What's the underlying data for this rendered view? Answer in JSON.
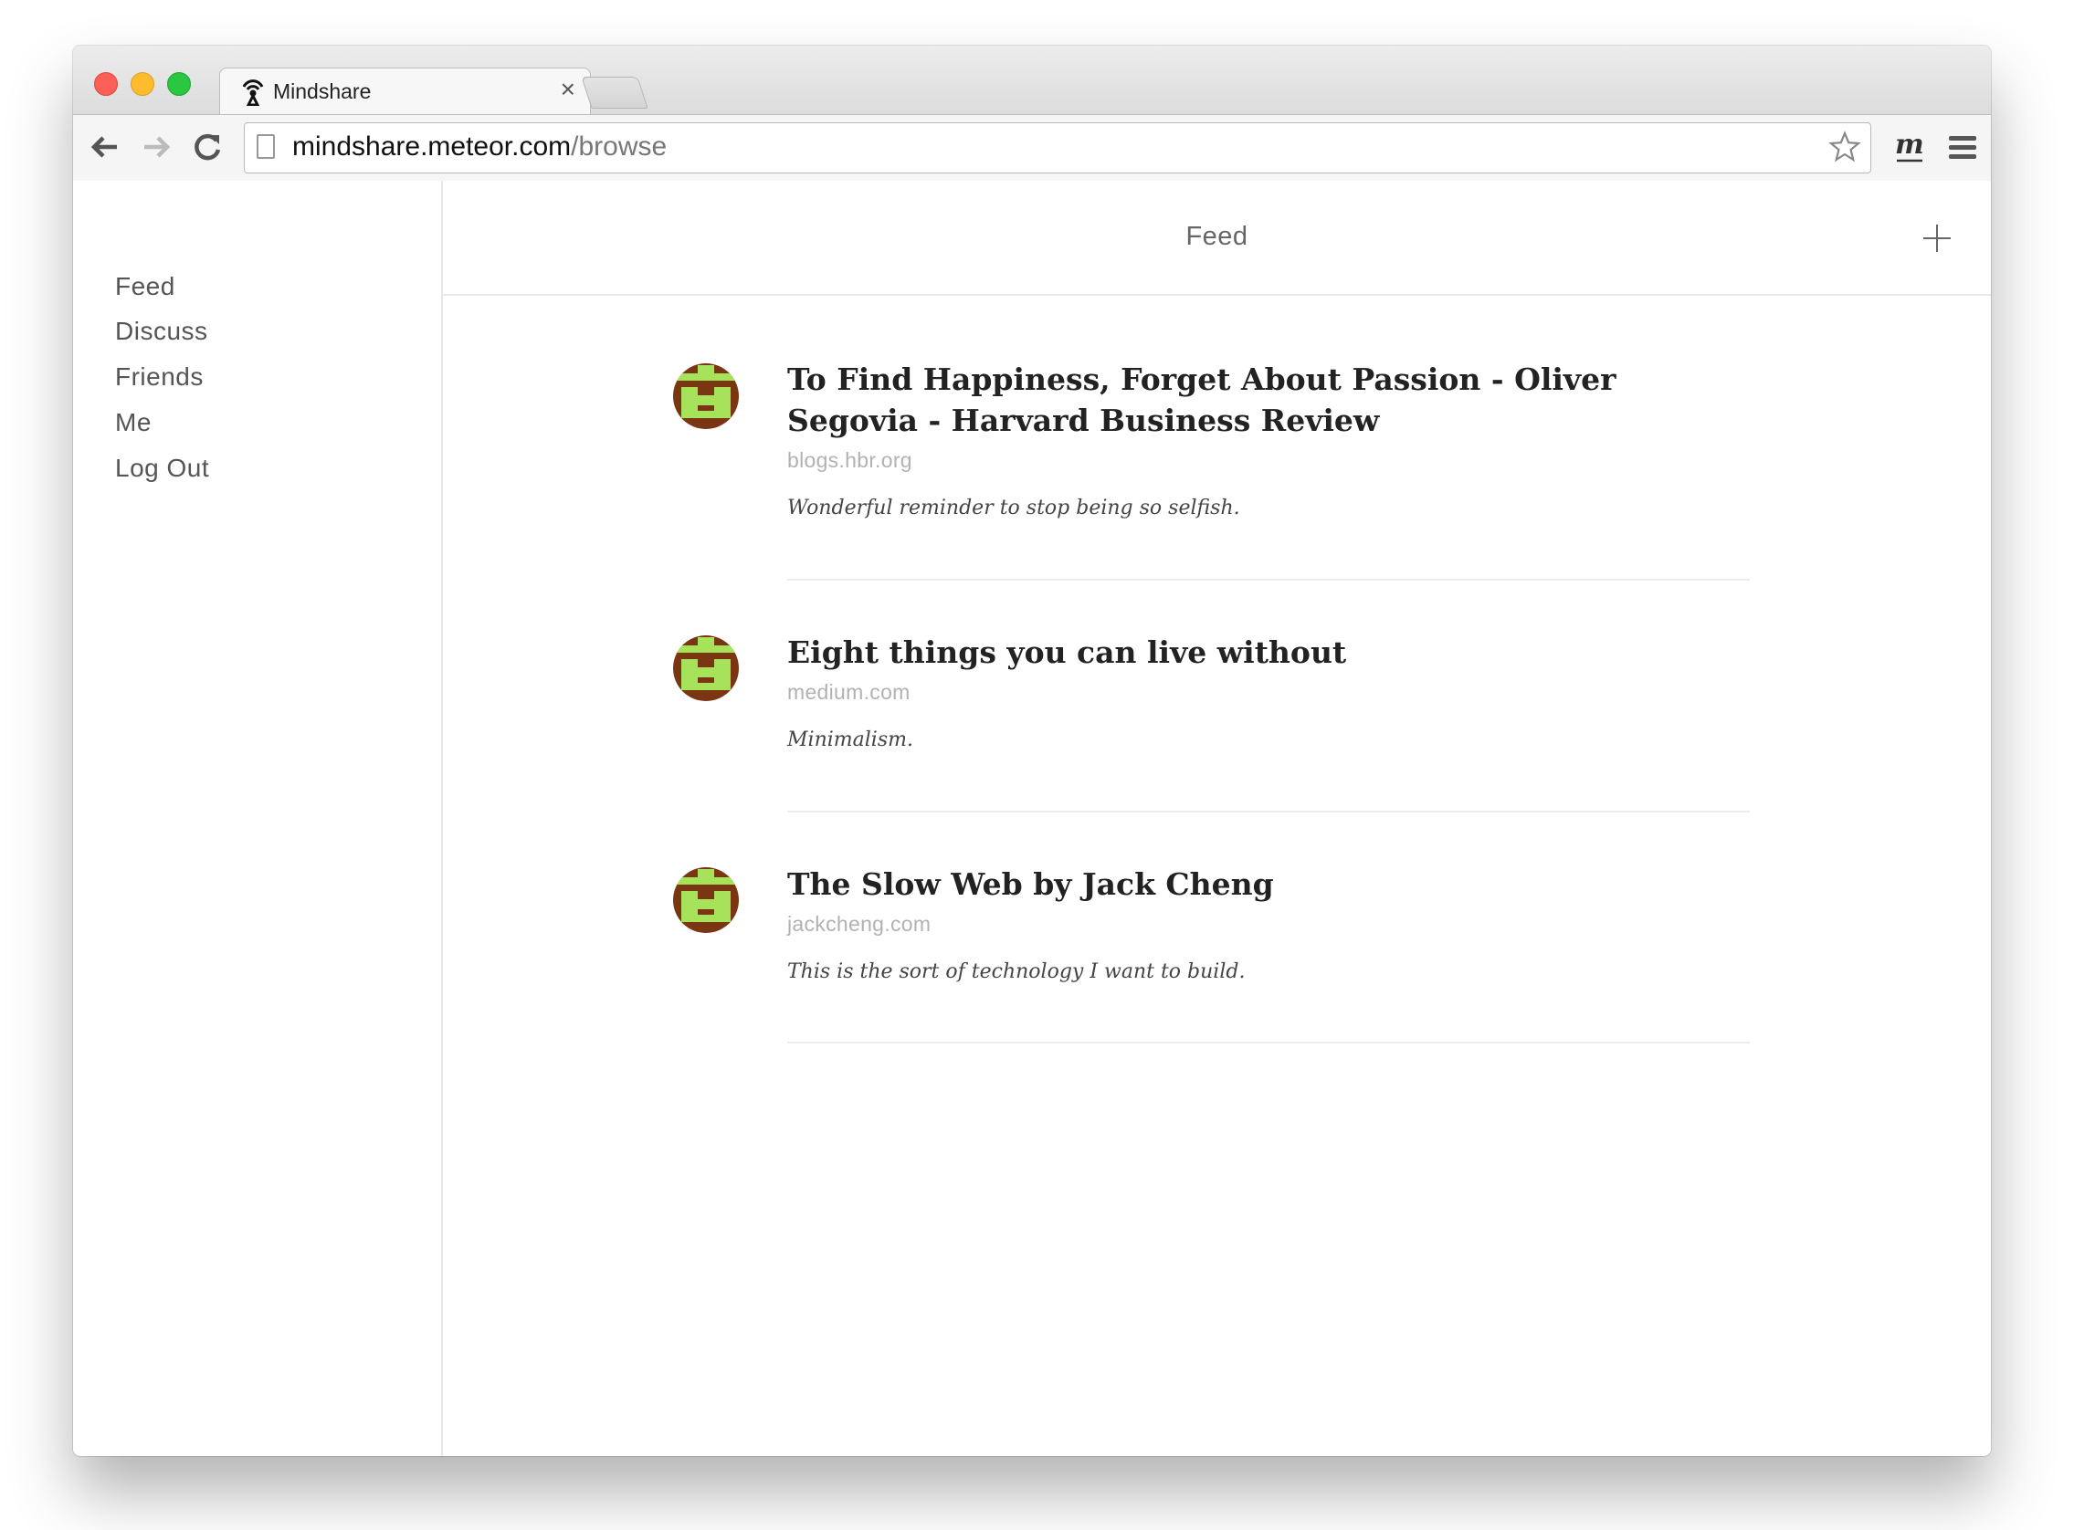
{
  "browser": {
    "tab_title": "Mindshare",
    "tab_close": "×",
    "url_host": "mindshare.meteor.com",
    "url_path": "/browse"
  },
  "sidebar": {
    "items": [
      {
        "label": "Feed"
      },
      {
        "label": "Discuss"
      },
      {
        "label": "Friends"
      },
      {
        "label": "Me"
      },
      {
        "label": "Log Out"
      }
    ]
  },
  "main": {
    "title": "Feed"
  },
  "feed": [
    {
      "title": "To Find Happiness, Forget About Passion - Oliver Segovia - Harvard Business Review",
      "domain": "blogs.hbr.org",
      "comment": "Wonderful reminder to stop being so selfish."
    },
    {
      "title": "Eight things you can live without",
      "domain": "medium.com",
      "comment": "Minimalism."
    },
    {
      "title": "The Slow Web by Jack Cheng",
      "domain": "jackcheng.com",
      "comment": "This is the sort of technology I want to build."
    }
  ],
  "colors": {
    "avatar_bg": "#7a3512",
    "avatar_fg": "#a6e25a"
  }
}
